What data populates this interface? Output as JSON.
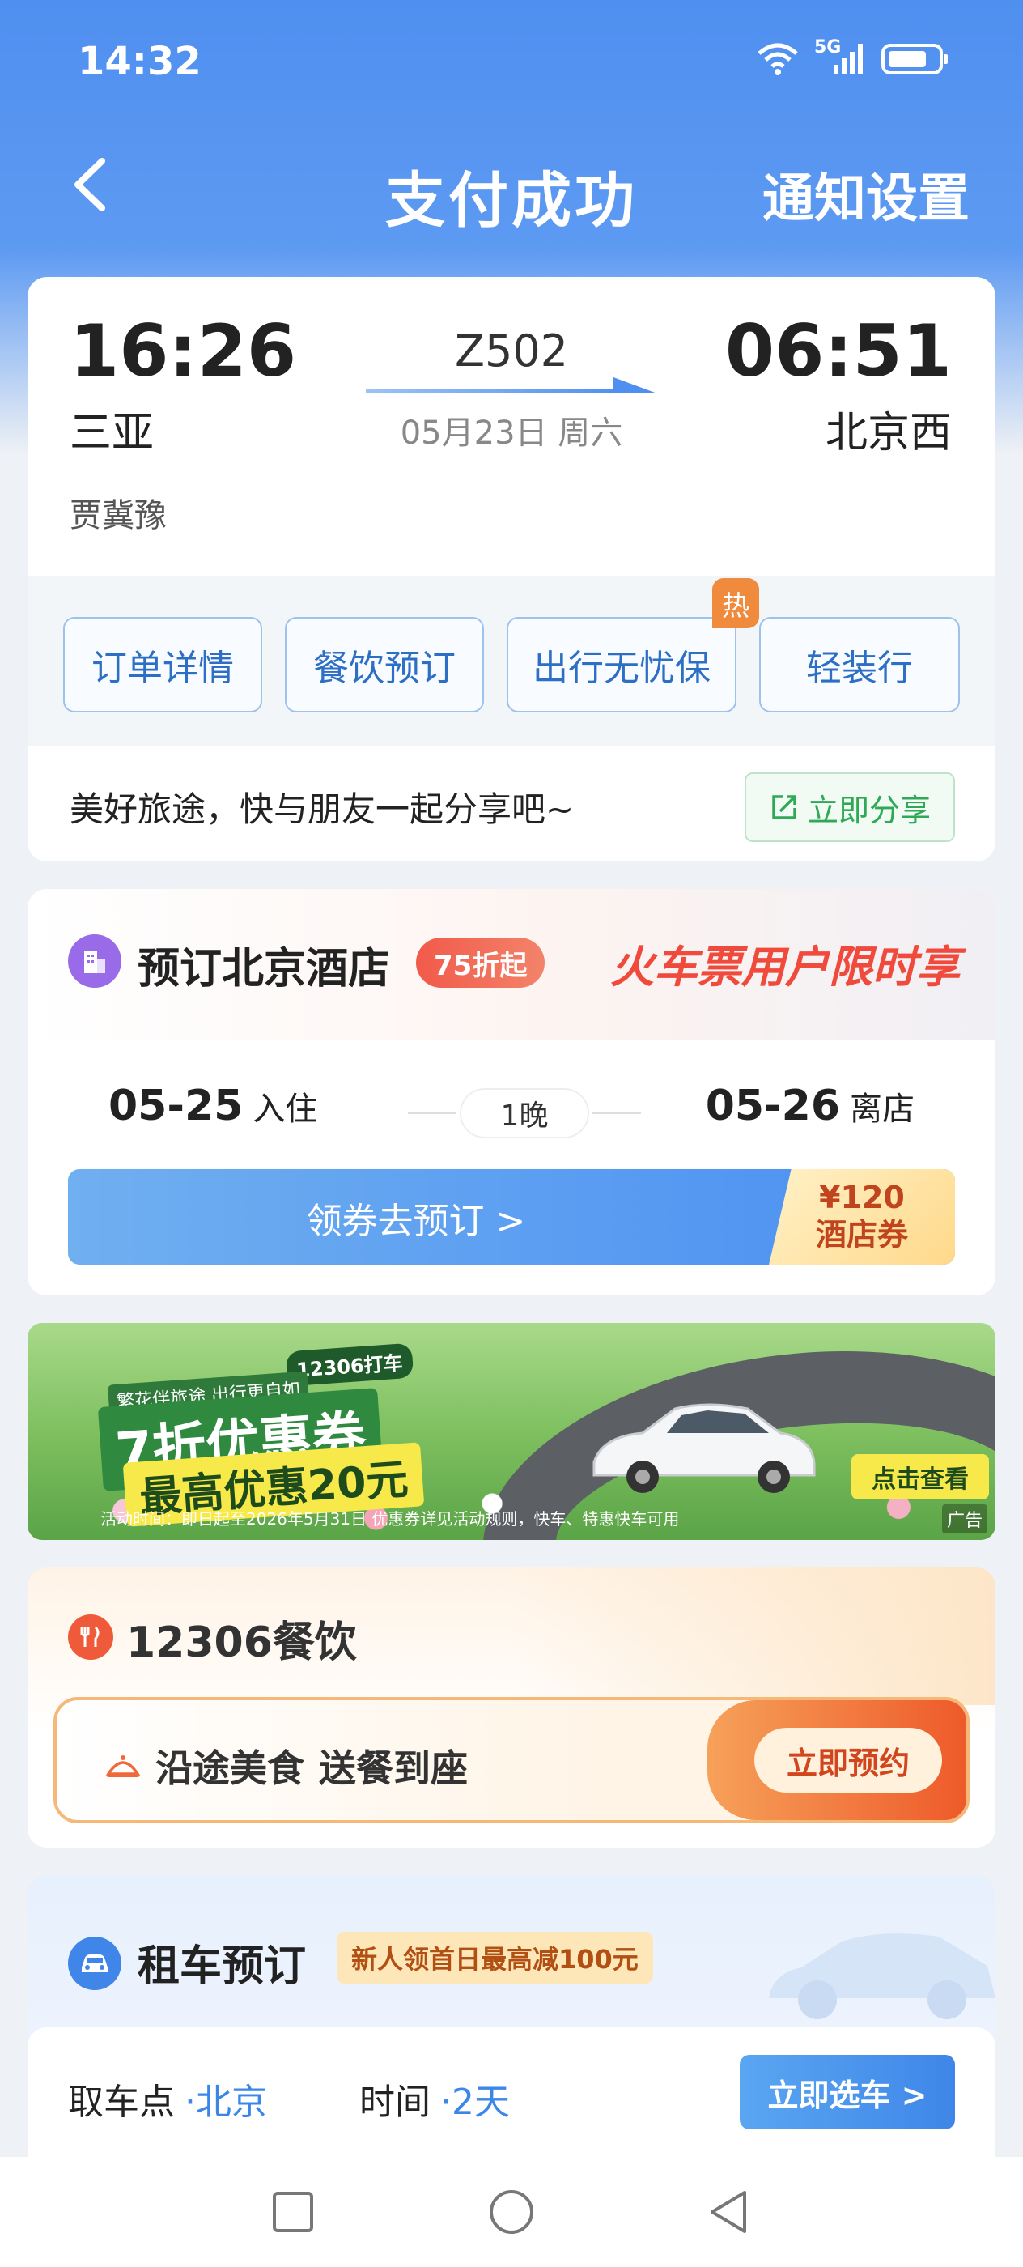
{
  "status_bar": {
    "time": "14:32",
    "network": "5G"
  },
  "nav": {
    "title": "支付成功",
    "right_action": "通知设置"
  },
  "trip": {
    "departure_time": "16:26",
    "departure_station": "三亚",
    "train_number": "Z502",
    "date": "05月23日 周六",
    "arrival_time": "06:51",
    "arrival_station": "北京西",
    "passenger": "贾冀豫"
  },
  "actions": [
    {
      "label": "订单详情"
    },
    {
      "label": "餐饮预订"
    },
    {
      "label": "出行无忧保",
      "badge": "热"
    },
    {
      "label": "轻装行"
    }
  ],
  "share": {
    "text": "美好旅途，快与朋友一起分享吧~",
    "button": "立即分享"
  },
  "hotel": {
    "title": "预订北京酒店",
    "discount": "75折起",
    "slogan": "火车票用户限时享",
    "checkin_date": "05-25",
    "checkin_label": "入住",
    "nights": "1晚",
    "checkout_date": "05-26",
    "checkout_label": "离店",
    "cta": "领券去预订 >",
    "coupon_amount": "¥120",
    "coupon_label": "酒店券"
  },
  "ad": {
    "small_text": "繁花伴旅途 出行更自如",
    "tag": "12306打车",
    "headline": "7折优惠券",
    "subline": "最高优惠20元",
    "fine_print": "活动时间：即日起至2026年5月31日 优惠券详见活动规则，快车、特惠快车可用",
    "button": "点击查看",
    "ad_label": "广告"
  },
  "catering": {
    "title": "12306餐饮",
    "slogan_part1": "沿途美食",
    "slogan_part2": "送餐到座",
    "button": "立即预约"
  },
  "car_rental": {
    "title": "租车预订",
    "promo": "新人领首日最高减100元",
    "pickup_label": "取车点",
    "pickup_value": "·北京",
    "time_label": "时间",
    "time_value": "·2天",
    "button": "立即选车 >"
  },
  "colors": {
    "header_blue": "#4f8fef",
    "accent_blue": "#3f86e8",
    "accent_green": "#2fa956",
    "accent_red": "#ef4a3c",
    "accent_orange": "#ee5a2a"
  },
  "icons": {
    "back": "chevron-left-icon",
    "wifi": "wifi-icon",
    "signal": "signal-icon",
    "battery": "battery-icon",
    "share": "share-icon",
    "hotel": "building-icon",
    "food": "fork-knife-icon",
    "car": "car-icon"
  }
}
